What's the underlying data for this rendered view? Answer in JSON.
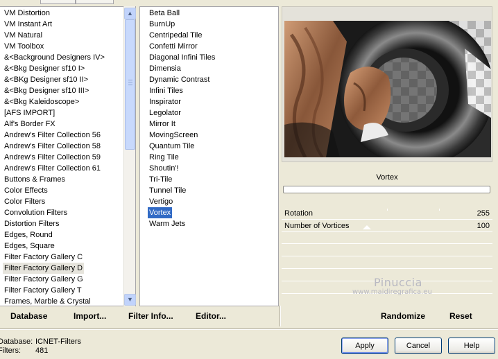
{
  "categories": {
    "items": [
      "VM Distortion",
      "VM Instant Art",
      "VM Natural",
      "VM Toolbox",
      "&<Background Designers IV>",
      "&<Bkg Designer sf10 I>",
      "&<BKg Designer sf10 II>",
      "&<Bkg Designer sf10 III>",
      "&<Bkg Kaleidoscope>",
      "[AFS IMPORT]",
      "Alf's Border FX",
      "Andrew's Filter Collection 56",
      "Andrew's Filter Collection 58",
      "Andrew's Filter Collection 59",
      "Andrew's Filter Collection 61",
      "Buttons & Frames",
      "Color Effects",
      "Color Filters",
      "Convolution Filters",
      "Distortion Filters",
      "Edges, Round",
      "Edges, Square",
      "Filter Factory Gallery C",
      "Filter Factory Gallery D",
      "Filter Factory Gallery G",
      "Filter Factory Gallery T",
      "Frames, Marble & Crystal"
    ],
    "highlighted_index": 23
  },
  "filters": {
    "items": [
      "Beta Ball",
      "BurnUp",
      "Centripedal Tile",
      "Confetti Mirror",
      "Diagonal Infini Tiles",
      "Dimensia",
      "Dynamic Contrast",
      "Infini Tiles",
      "Inspirator",
      "Legolator",
      "Mirror It",
      "MovingScreen",
      "Quantum Tile",
      "Ring Tile",
      "Shoutin'!",
      "Tri-Tile",
      "Tunnel Tile",
      "Vertigo",
      "Vortex",
      "Warm Jets"
    ],
    "selected_index": 18
  },
  "icons": {
    "scroll_up": "▲",
    "scroll_down": "▼"
  },
  "filter_name": "Vortex",
  "controls": [
    {
      "label": "Rotation",
      "value": "255"
    },
    {
      "label": "Number of Vortices",
      "value": "100"
    }
  ],
  "watermark": {
    "name": "Pinuccia",
    "url": "www.maidiregrafica.eu"
  },
  "toolbar": {
    "database": "Database",
    "import": "Import...",
    "filter_info": "Filter Info...",
    "editor": "Editor...",
    "randomize": "Randomize",
    "reset": "Reset"
  },
  "info": {
    "database_label": "Database:",
    "database_value": "ICNET-Filters",
    "filters_label": "Filters:",
    "filters_value": "481"
  },
  "buttons": {
    "apply": "Apply",
    "cancel": "Cancel",
    "help": "Help"
  },
  "colors": {
    "selection": "#316ac5",
    "dialog_bg": "#ece9d8",
    "button_border": "#003c74"
  }
}
